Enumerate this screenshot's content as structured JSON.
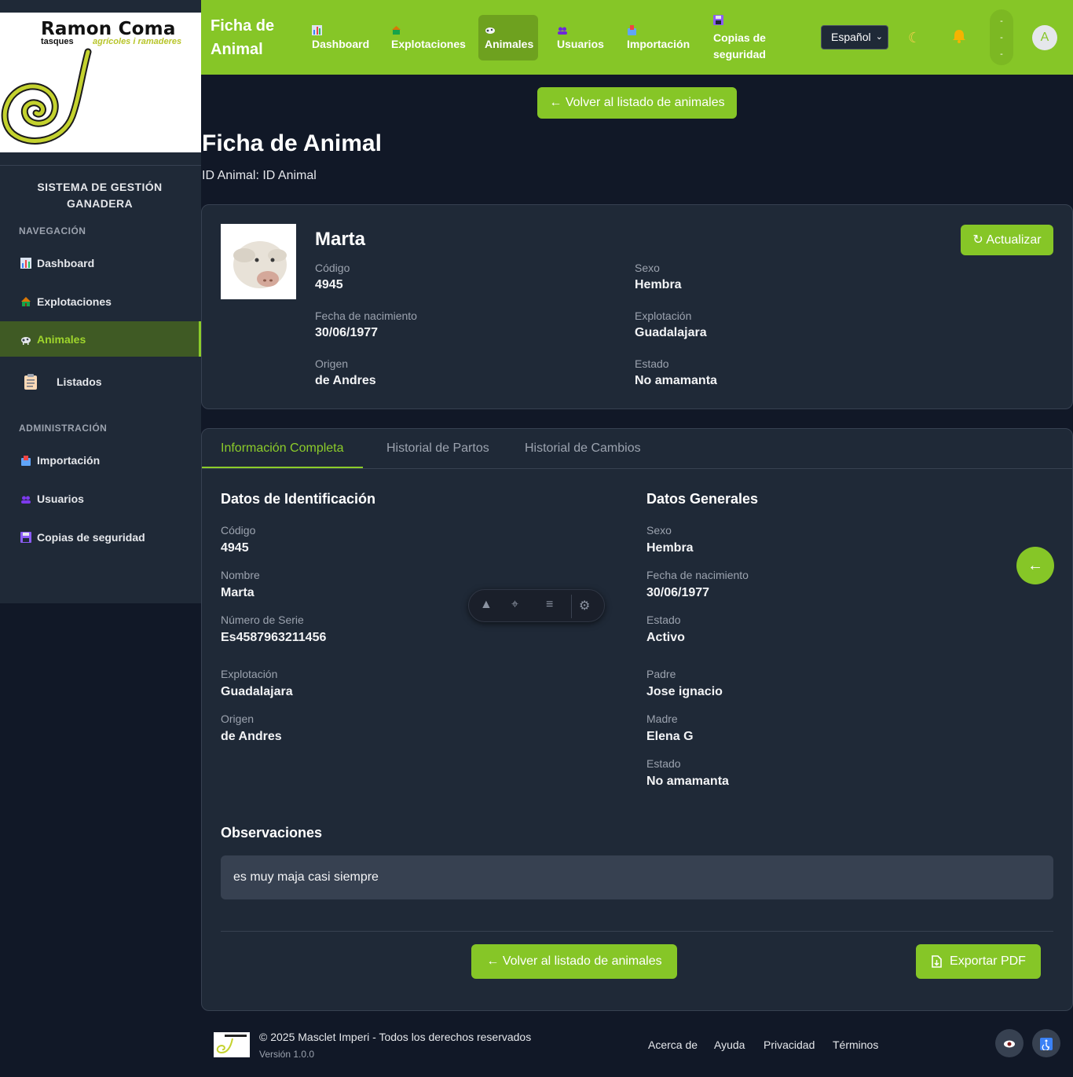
{
  "logo": {
    "title": "Ramon Coma",
    "subtitle_left": "tasques",
    "subtitle_right": "agrícoles i ramaderes"
  },
  "sidebar": {
    "system_title": "SISTEMA DE GESTIÓN GANADERA",
    "nav_section": "NAVEGACIÓN",
    "admin_section": "ADMINISTRACIÓN",
    "items": [
      {
        "label": "Dashboard",
        "icon": "chart-icon"
      },
      {
        "label": "Explotaciones",
        "icon": "farm-icon"
      },
      {
        "label": "Animales",
        "icon": "cow-icon",
        "active": true
      },
      {
        "label": "Listados",
        "icon": "clipboard-icon"
      }
    ],
    "admin_items": [
      {
        "label": "Importación",
        "icon": "inbox-icon"
      },
      {
        "label": "Usuarios",
        "icon": "users-icon"
      },
      {
        "label": "Copias de seguridad",
        "icon": "floppy-icon"
      }
    ]
  },
  "topbar": {
    "title": "Ficha de Animal",
    "nav": [
      {
        "label": "Dashboard",
        "icon": "chart-icon"
      },
      {
        "label": "Explotaciones",
        "icon": "farm-icon"
      },
      {
        "label": "Animales",
        "icon": "cow-icon",
        "active": true
      },
      {
        "label": "Usuarios",
        "icon": "users-icon"
      },
      {
        "label": "Importación",
        "icon": "inbox-icon"
      },
      {
        "label": "Copias de seguridad",
        "icon": "floppy-icon"
      }
    ],
    "language": "Español",
    "avatar_letter": "A",
    "pill_text": "- - -"
  },
  "back_top_label": "← Volver al listado de animales",
  "page": {
    "title": "Ficha de Animal",
    "subtitle": "ID Animal: ID Animal"
  },
  "header_card": {
    "name": "Marta",
    "refresh_label": "↻ Actualizar",
    "fields": {
      "codigo_label": "Código",
      "codigo": "4945",
      "sexo_label": "Sexo",
      "sexo": "Hembra",
      "nacimiento_label": "Fecha de nacimiento",
      "nacimiento": "30/06/1977",
      "explotacion_label": "Explotación",
      "explotacion": "Guadalajara",
      "origen_label": "Origen",
      "origen": "de Andres",
      "estado_label": "Estado",
      "estado": "No amamanta"
    }
  },
  "tabs": [
    "Información Completa",
    "Historial de Partos",
    "Historial de Cambios"
  ],
  "identificacion": {
    "title": "Datos de Identificación",
    "codigo_label": "Código",
    "codigo": "4945",
    "nombre_label": "Nombre",
    "nombre": "Marta",
    "serie_label": "Número de Serie",
    "serie": "Es4587963211456",
    "explotacion_label": "Explotación",
    "explotacion": "Guadalajara",
    "origen_label": "Origen",
    "origen": "de Andres"
  },
  "generales": {
    "title": "Datos Generales",
    "sexo_label": "Sexo",
    "sexo": "Hembra",
    "nacimiento_label": "Fecha de nacimiento",
    "nacimiento": "30/06/1977",
    "estado_label": "Estado",
    "estado": "Activo",
    "padre_label": "Padre",
    "padre": "Jose ignacio",
    "madre_label": "Madre",
    "madre": "Elena G",
    "estado2_label": "Estado",
    "estado2": "No amamanta"
  },
  "observaciones": {
    "title": "Observaciones",
    "text": "es muy maja casi siempre"
  },
  "actions": {
    "back_label": "← Volver al listado de animales",
    "export_label": "Exportar PDF"
  },
  "footer": {
    "copyright": "© 2025 Masclet Imperi - Todos los derechos reservados",
    "version": "Versión 1.0.0",
    "links": [
      "Acerca de",
      "Ayuda",
      "Privacidad",
      "Términos"
    ]
  },
  "colors": {
    "brand_green": "#86c627",
    "bg": "#111827",
    "card": "#1f2937"
  }
}
